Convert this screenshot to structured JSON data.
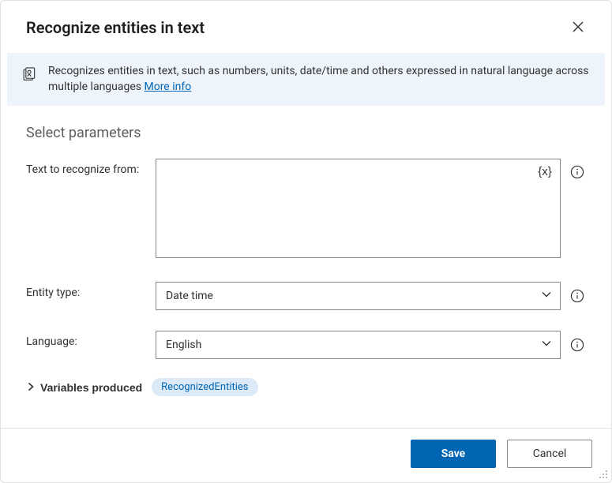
{
  "dialog": {
    "title": "Recognize entities in text"
  },
  "banner": {
    "text": "Recognizes entities in text, such as numbers, units, date/time and others expressed in natural language across multiple languages ",
    "more_info": "More info"
  },
  "section": {
    "heading": "Select parameters"
  },
  "fields": {
    "text_to_recognize": {
      "label": "Text to recognize from:",
      "value": "",
      "variable_token_label": "{x}"
    },
    "entity_type": {
      "label": "Entity type:",
      "value": "Date time"
    },
    "language": {
      "label": "Language:",
      "value": "English"
    }
  },
  "variables_produced": {
    "label": "Variables produced",
    "items": [
      "RecognizedEntities"
    ]
  },
  "footer": {
    "save": "Save",
    "cancel": "Cancel"
  }
}
